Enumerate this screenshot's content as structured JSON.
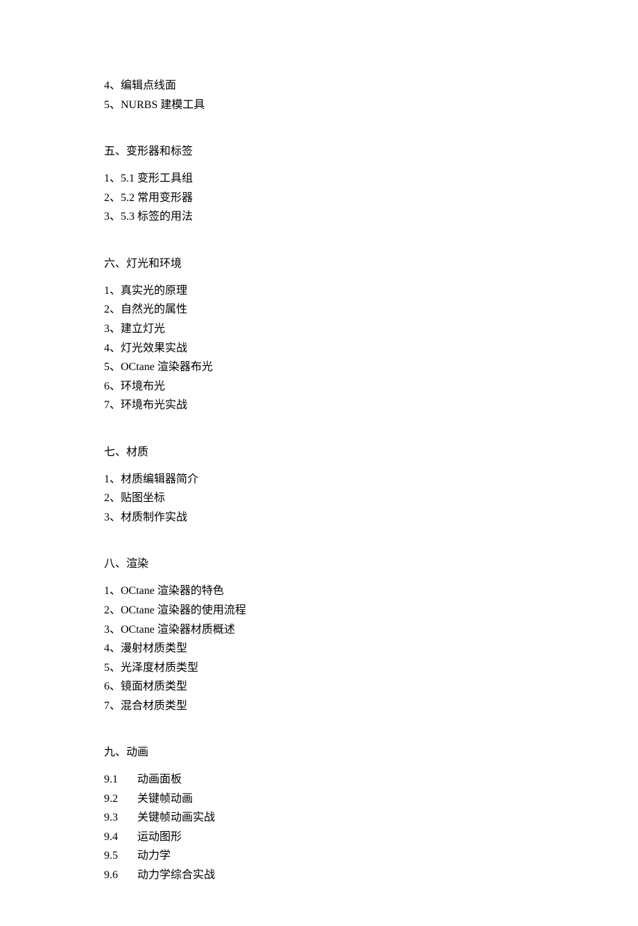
{
  "continued_section": {
    "items": [
      "4、编辑点线面",
      "5、NURBS 建模工具"
    ]
  },
  "sections": [
    {
      "title": "五、变形器和标签",
      "items": [
        "1、5.1 变形工具组",
        "2、5.2 常用变形器",
        "3、5.3 标签的用法"
      ]
    },
    {
      "title": "六、灯光和环境",
      "items": [
        "1、真实光的原理",
        "2、自然光的属性",
        "3、建立灯光",
        "4、灯光效果实战",
        "5、OCtane 渲染器布光",
        "6、环境布光",
        "7、环境布光实战"
      ]
    },
    {
      "title": "七、材质",
      "items": [
        "1、材质编辑器简介",
        "2、贴图坐标",
        "3、材质制作实战"
      ]
    },
    {
      "title": "八、渲染",
      "items": [
        "1、OCtane 渲染器的特色",
        "2、OCtane 渲染器的使用流程",
        "3、OCtane 渲染器材质概述",
        "4、漫射材质类型",
        "5、光泽度材质类型",
        "6、镜面材质类型",
        "7、混合材质类型"
      ]
    },
    {
      "title": "九、动画",
      "subitems": [
        {
          "num": "9.1",
          "label": "动画面板"
        },
        {
          "num": "9.2",
          "label": "关键帧动画"
        },
        {
          "num": "9.3",
          "label": "关键帧动画实战"
        },
        {
          "num": "9.4",
          "label": "运动图形"
        },
        {
          "num": "9.5",
          "label": "动力学"
        },
        {
          "num": "9.6",
          "label": "动力学综合实战"
        }
      ]
    }
  ]
}
